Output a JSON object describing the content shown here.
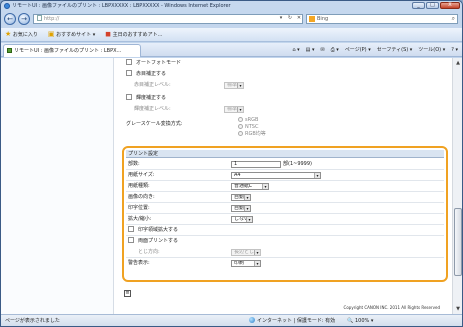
{
  "window": {
    "title": "リモートUI : 画像ファイルのプリント : LBPXXXXX : LBPXXXXX - Windows Internet Explorer",
    "minimize": "_",
    "maximize": "□",
    "close": "X"
  },
  "address_bar": {
    "url": "http://",
    "search_engine": "Bing"
  },
  "favorites_bar": {
    "favorites": "お気に入り",
    "suggested": "おすすめサイト ▾",
    "web_slice": "主日のおすすめアト..."
  },
  "tab": {
    "label": "リモートUI : 画像ファイルのプリント : LBPX..."
  },
  "command_bar": {
    "page": "ページ(P) ▾",
    "safety": "セーフティ(S) ▾",
    "tools": "ツール(O) ▾",
    "help": "? ▾"
  },
  "image_options": {
    "auto_mode": "オートフォトモード",
    "sharpness": "赤目補正する",
    "sharpness_level_label": "赤目補正レベル:",
    "sharpness_level_value": "標準",
    "brightness": "輝度補正する",
    "brightness_level_label": "輝度補正レベル:",
    "brightness_level_value": "標準",
    "grayscale_label": "グレースケール変換方式:",
    "grayscale_options": [
      "sRGB",
      "NTSC",
      "RGB均等"
    ]
  },
  "print_settings": {
    "title": "プリント設定",
    "copies_label": "部数:",
    "copies_value": "1",
    "copies_hint": "部(1~9999)",
    "paper_size_label": "用紙サイズ:",
    "paper_size_value": "A4",
    "paper_type_label": "用紙種類:",
    "paper_type_value": "普通紙L",
    "orientation_label": "画像の向き:",
    "orientation_value": "自動",
    "position_label": "印字位置:",
    "position_value": "自動",
    "scale_label": "拡大/縮小:",
    "scale_value": "しない",
    "fit_label": "印字領域拡大する",
    "duplex_label": "両面プリントする",
    "binding_label": "とじ方向:",
    "binding_value": "長辺とじ",
    "warning_label": "警告表示:",
    "warning_value": "印刷"
  },
  "footer": {
    "copyright": "Copyright CANON INC. 2011 All Rights Reserved"
  },
  "status_bar": {
    "message": "ページが表示されました",
    "zone": "インターネット | 保護モード: 有効",
    "zoom": "100%"
  }
}
